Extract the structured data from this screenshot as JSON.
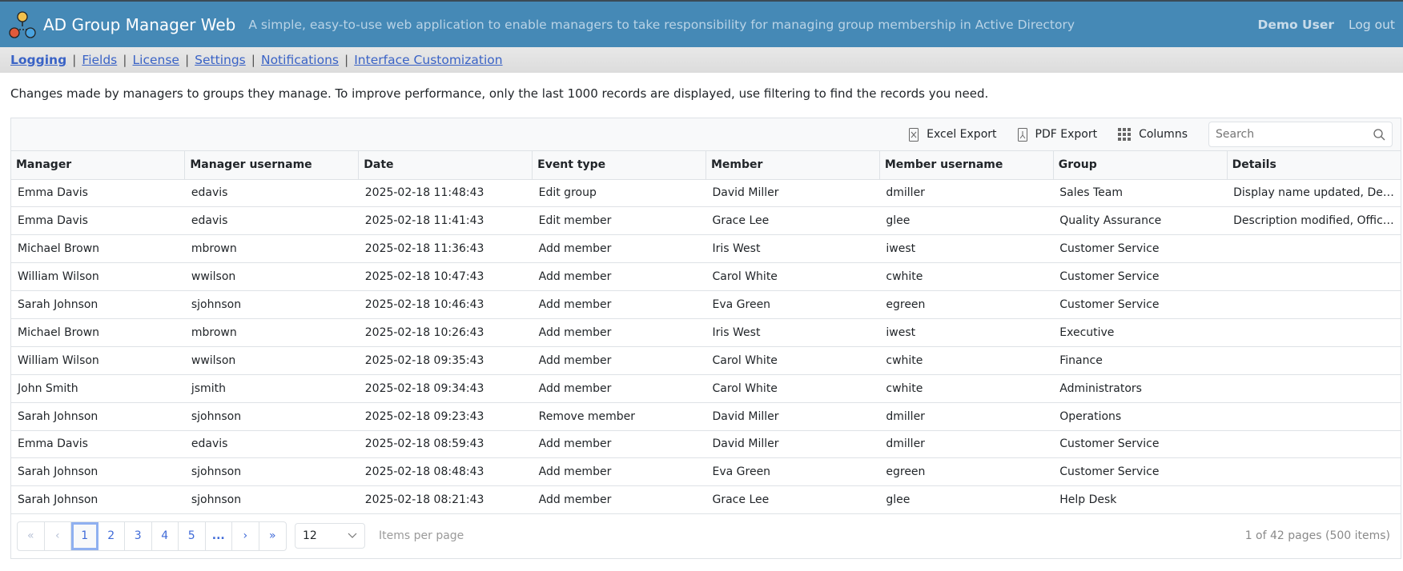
{
  "header": {
    "title": "AD Group Manager Web",
    "tagline": "A simple, easy-to-use web application to enable managers to take responsibility for managing group membership in Active Directory",
    "user": "Demo User",
    "logout": "Log out"
  },
  "nav": {
    "items": [
      {
        "label": "Logging",
        "active": true
      },
      {
        "label": "Fields"
      },
      {
        "label": "License"
      },
      {
        "label": "Settings"
      },
      {
        "label": "Notifications"
      },
      {
        "label": "Interface Customization"
      }
    ]
  },
  "description": "Changes made by managers to groups they manage. To improve performance, only the last 1000 records are displayed, use filtering to find the records you need.",
  "toolbar": {
    "excel": "Excel Export",
    "pdf": "PDF Export",
    "columns": "Columns",
    "search_placeholder": "Search"
  },
  "columns": [
    "Manager",
    "Manager username",
    "Date",
    "Event type",
    "Member",
    "Member username",
    "Group",
    "Details"
  ],
  "rows": [
    [
      "Emma Davis",
      "edavis",
      "2025-02-18 11:48:43",
      "Edit group",
      "David Miller",
      "dmiller",
      "Sales Team",
      "Display name updated, Department changed"
    ],
    [
      "Emma Davis",
      "edavis",
      "2025-02-18 11:41:43",
      "Edit member",
      "Grace Lee",
      "glee",
      "Quality Assurance",
      "Description modified, Office location changed"
    ],
    [
      "Michael Brown",
      "mbrown",
      "2025-02-18 11:36:43",
      "Add member",
      "Iris West",
      "iwest",
      "Customer Service",
      ""
    ],
    [
      "William Wilson",
      "wwilson",
      "2025-02-18 10:47:43",
      "Add member",
      "Carol White",
      "cwhite",
      "Customer Service",
      ""
    ],
    [
      "Sarah Johnson",
      "sjohnson",
      "2025-02-18 10:46:43",
      "Add member",
      "Eva Green",
      "egreen",
      "Customer Service",
      ""
    ],
    [
      "Michael Brown",
      "mbrown",
      "2025-02-18 10:26:43",
      "Add member",
      "Iris West",
      "iwest",
      "Executive",
      ""
    ],
    [
      "William Wilson",
      "wwilson",
      "2025-02-18 09:35:43",
      "Add member",
      "Carol White",
      "cwhite",
      "Finance",
      ""
    ],
    [
      "John Smith",
      "jsmith",
      "2025-02-18 09:34:43",
      "Add member",
      "Carol White",
      "cwhite",
      "Administrators",
      ""
    ],
    [
      "Sarah Johnson",
      "sjohnson",
      "2025-02-18 09:23:43",
      "Remove member",
      "David Miller",
      "dmiller",
      "Operations",
      ""
    ],
    [
      "Emma Davis",
      "edavis",
      "2025-02-18 08:59:43",
      "Add member",
      "David Miller",
      "dmiller",
      "Customer Service",
      ""
    ],
    [
      "Sarah Johnson",
      "sjohnson",
      "2025-02-18 08:48:43",
      "Add member",
      "Eva Green",
      "egreen",
      "Customer Service",
      ""
    ],
    [
      "Sarah Johnson",
      "sjohnson",
      "2025-02-18 08:21:43",
      "Add member",
      "Grace Lee",
      "glee",
      "Help Desk",
      ""
    ]
  ],
  "pager": {
    "buttons": [
      "«",
      "‹",
      "1",
      "2",
      "3",
      "4",
      "5",
      "...",
      "›",
      "»"
    ],
    "current": "1",
    "page_size": "12",
    "items_per_page": "Items per page",
    "info": "1 of 42 pages (500 items)"
  },
  "colors": {
    "header_bg": "#4589b6",
    "link": "#3a63c6",
    "pager_accent": "#3f6ad8"
  }
}
